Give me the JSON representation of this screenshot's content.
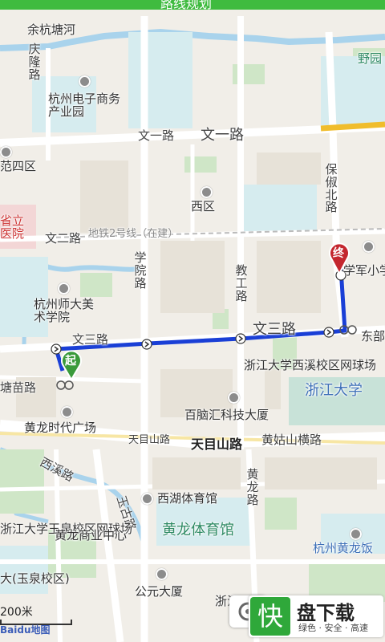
{
  "header": {
    "title": "路线规划"
  },
  "labels": {
    "yuhang_tanghe": "余杭塘河",
    "qinghe_lu": "庆隆路",
    "ye_yuan": "野园",
    "hz_electronics": "杭州电子商务产业园",
    "wenyi_lu_small": "文一路",
    "wenyi_lu_big": "文一路",
    "sanqu": "范四区",
    "baochu_bei_lu": "保俶北路",
    "xiqu": "西区",
    "province_hospital": "省立医院",
    "wen_er_lu": "文二路",
    "metro_line2": "地铁2号线（在建）",
    "xueyuan_lu": "学院路",
    "jiaogong_lu": "教工路",
    "xuejun_school": "学军小学",
    "hz_normal_art": "杭州师大美术学院",
    "wen_san_lu_left": "文三路",
    "wen_san_lu_mid": "文三路",
    "dongbu": "东部",
    "zju_xixi_court": "浙江大学西溪校区网球场",
    "zju": "浙江大学",
    "tangmiao_lu": "塘苗路",
    "huanglong_times": "黄龙时代广场",
    "baiaohui": "百脑汇科技大厦",
    "tianmushan_lu_small": "天目山路",
    "tianmushan_lu_big": "天目山路",
    "huanggushan_heng_lu": "黄姑山横路",
    "xixi_lu": "西溪路",
    "wangu_lu": "玉古路",
    "xihu_stadium": "西湖体育馆",
    "huanglong_lu": "黄龙路",
    "zju_yuquan_court": "浙江大学玉泉校区网球场",
    "huanglong_stadium": "黄龙体育馆",
    "huanglong_yuan": "黄龙商业中心",
    "hz_huanglong_hotel": "杭州黄龙饭",
    "yuquan_campus": "大(玉泉校区)",
    "gongyuan_building": "公元大厦",
    "zhe": "浙江"
  },
  "route": {
    "start_label": "起",
    "end_label": "终",
    "color": "#1a3fd6"
  },
  "scale": {
    "text": "200米"
  },
  "attribution": {
    "text": "Baidu地图"
  },
  "watermark": {
    "logo_text": "快",
    "name": "盘下载",
    "slogan": "绿色 · 安全 · 高速"
  }
}
